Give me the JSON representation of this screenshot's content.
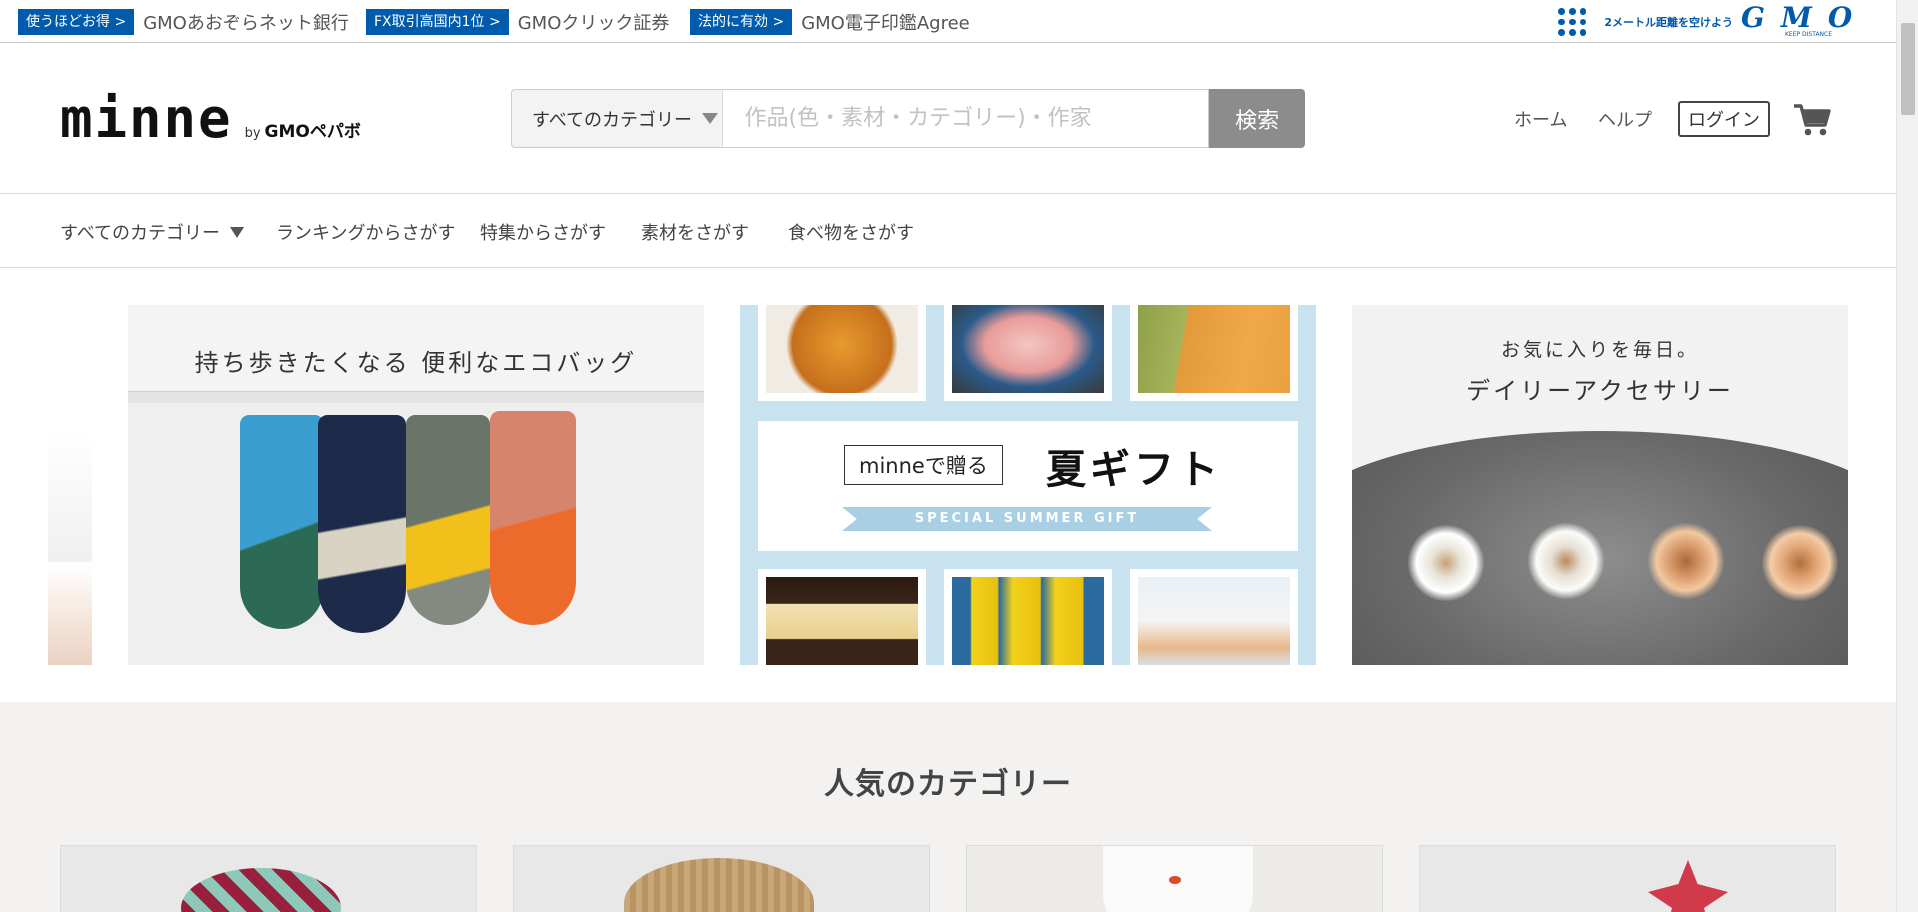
{
  "gmo_bar": {
    "promos": [
      {
        "badge": "使うほどお得 >",
        "text": "GMOあおぞらネット銀行"
      },
      {
        "badge": "FX取引高国内1位 >",
        "text": "GMOクリック証券"
      },
      {
        "badge": "法的に有効 >",
        "text": "GMO電子印鑑Agree"
      }
    ],
    "distance_text": "2メートル距離を空けよう",
    "logo_text": "GMO",
    "keep_distance": "KEEP DISTANCE"
  },
  "header": {
    "logo": "minne",
    "by": "by",
    "pepabo": "GMOペパボ",
    "category_select": "すべてのカテゴリー",
    "search_placeholder": "作品(色・素材・カテゴリー)・作家",
    "search_button": "検索",
    "nav": {
      "home": "ホーム",
      "help": "ヘルプ",
      "login": "ログイン"
    }
  },
  "category_nav": {
    "all": "すべてのカテゴリー",
    "items": [
      "ランキングからさがす",
      "特集からさがす",
      "素材をさがす",
      "食べ物をさがす"
    ]
  },
  "banners": {
    "eco_bag": {
      "title": "持ち歩きたくなる 便利なエコバッグ"
    },
    "summer_gift": {
      "minne": "minneで贈る",
      "main": "夏ギフト",
      "ribbon": "SPECIAL SUMMER GIFT"
    },
    "accessory": {
      "sub": "お気に入りを毎日。",
      "main": "デイリーアクセサリー"
    }
  },
  "popular": {
    "title": "人気のカテゴリー"
  },
  "colors": {
    "gmo_blue": "#005bac",
    "search_button": "#8c8c8c",
    "gift_blue": "#c9e2f0",
    "popular_bg": "#f3f2f0"
  }
}
